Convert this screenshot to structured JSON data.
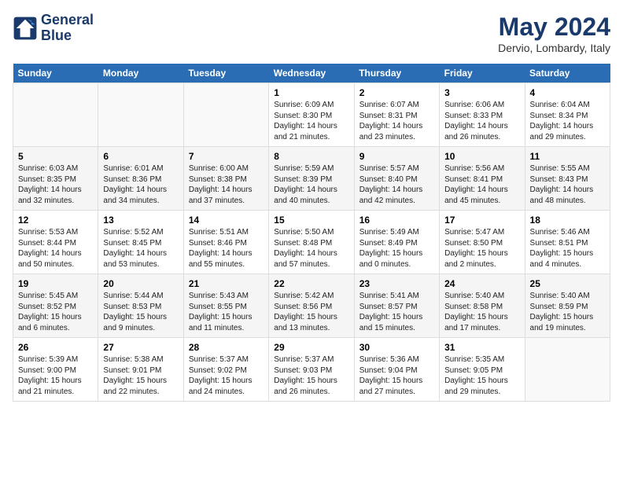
{
  "header": {
    "logo_line1": "General",
    "logo_line2": "Blue",
    "main_title": "May 2024",
    "subtitle": "Dervio, Lombardy, Italy"
  },
  "weekdays": [
    "Sunday",
    "Monday",
    "Tuesday",
    "Wednesday",
    "Thursday",
    "Friday",
    "Saturday"
  ],
  "weeks": [
    [
      {
        "day": "",
        "content": ""
      },
      {
        "day": "",
        "content": ""
      },
      {
        "day": "",
        "content": ""
      },
      {
        "day": "1",
        "content": "Sunrise: 6:09 AM\nSunset: 8:30 PM\nDaylight: 14 hours\nand 21 minutes."
      },
      {
        "day": "2",
        "content": "Sunrise: 6:07 AM\nSunset: 8:31 PM\nDaylight: 14 hours\nand 23 minutes."
      },
      {
        "day": "3",
        "content": "Sunrise: 6:06 AM\nSunset: 8:33 PM\nDaylight: 14 hours\nand 26 minutes."
      },
      {
        "day": "4",
        "content": "Sunrise: 6:04 AM\nSunset: 8:34 PM\nDaylight: 14 hours\nand 29 minutes."
      }
    ],
    [
      {
        "day": "5",
        "content": "Sunrise: 6:03 AM\nSunset: 8:35 PM\nDaylight: 14 hours\nand 32 minutes."
      },
      {
        "day": "6",
        "content": "Sunrise: 6:01 AM\nSunset: 8:36 PM\nDaylight: 14 hours\nand 34 minutes."
      },
      {
        "day": "7",
        "content": "Sunrise: 6:00 AM\nSunset: 8:38 PM\nDaylight: 14 hours\nand 37 minutes."
      },
      {
        "day": "8",
        "content": "Sunrise: 5:59 AM\nSunset: 8:39 PM\nDaylight: 14 hours\nand 40 minutes."
      },
      {
        "day": "9",
        "content": "Sunrise: 5:57 AM\nSunset: 8:40 PM\nDaylight: 14 hours\nand 42 minutes."
      },
      {
        "day": "10",
        "content": "Sunrise: 5:56 AM\nSunset: 8:41 PM\nDaylight: 14 hours\nand 45 minutes."
      },
      {
        "day": "11",
        "content": "Sunrise: 5:55 AM\nSunset: 8:43 PM\nDaylight: 14 hours\nand 48 minutes."
      }
    ],
    [
      {
        "day": "12",
        "content": "Sunrise: 5:53 AM\nSunset: 8:44 PM\nDaylight: 14 hours\nand 50 minutes."
      },
      {
        "day": "13",
        "content": "Sunrise: 5:52 AM\nSunset: 8:45 PM\nDaylight: 14 hours\nand 53 minutes."
      },
      {
        "day": "14",
        "content": "Sunrise: 5:51 AM\nSunset: 8:46 PM\nDaylight: 14 hours\nand 55 minutes."
      },
      {
        "day": "15",
        "content": "Sunrise: 5:50 AM\nSunset: 8:48 PM\nDaylight: 14 hours\nand 57 minutes."
      },
      {
        "day": "16",
        "content": "Sunrise: 5:49 AM\nSunset: 8:49 PM\nDaylight: 15 hours\nand 0 minutes."
      },
      {
        "day": "17",
        "content": "Sunrise: 5:47 AM\nSunset: 8:50 PM\nDaylight: 15 hours\nand 2 minutes."
      },
      {
        "day": "18",
        "content": "Sunrise: 5:46 AM\nSunset: 8:51 PM\nDaylight: 15 hours\nand 4 minutes."
      }
    ],
    [
      {
        "day": "19",
        "content": "Sunrise: 5:45 AM\nSunset: 8:52 PM\nDaylight: 15 hours\nand 6 minutes."
      },
      {
        "day": "20",
        "content": "Sunrise: 5:44 AM\nSunset: 8:53 PM\nDaylight: 15 hours\nand 9 minutes."
      },
      {
        "day": "21",
        "content": "Sunrise: 5:43 AM\nSunset: 8:55 PM\nDaylight: 15 hours\nand 11 minutes."
      },
      {
        "day": "22",
        "content": "Sunrise: 5:42 AM\nSunset: 8:56 PM\nDaylight: 15 hours\nand 13 minutes."
      },
      {
        "day": "23",
        "content": "Sunrise: 5:41 AM\nSunset: 8:57 PM\nDaylight: 15 hours\nand 15 minutes."
      },
      {
        "day": "24",
        "content": "Sunrise: 5:40 AM\nSunset: 8:58 PM\nDaylight: 15 hours\nand 17 minutes."
      },
      {
        "day": "25",
        "content": "Sunrise: 5:40 AM\nSunset: 8:59 PM\nDaylight: 15 hours\nand 19 minutes."
      }
    ],
    [
      {
        "day": "26",
        "content": "Sunrise: 5:39 AM\nSunset: 9:00 PM\nDaylight: 15 hours\nand 21 minutes."
      },
      {
        "day": "27",
        "content": "Sunrise: 5:38 AM\nSunset: 9:01 PM\nDaylight: 15 hours\nand 22 minutes."
      },
      {
        "day": "28",
        "content": "Sunrise: 5:37 AM\nSunset: 9:02 PM\nDaylight: 15 hours\nand 24 minutes."
      },
      {
        "day": "29",
        "content": "Sunrise: 5:37 AM\nSunset: 9:03 PM\nDaylight: 15 hours\nand 26 minutes."
      },
      {
        "day": "30",
        "content": "Sunrise: 5:36 AM\nSunset: 9:04 PM\nDaylight: 15 hours\nand 27 minutes."
      },
      {
        "day": "31",
        "content": "Sunrise: 5:35 AM\nSunset: 9:05 PM\nDaylight: 15 hours\nand 29 minutes."
      },
      {
        "day": "",
        "content": ""
      }
    ]
  ]
}
